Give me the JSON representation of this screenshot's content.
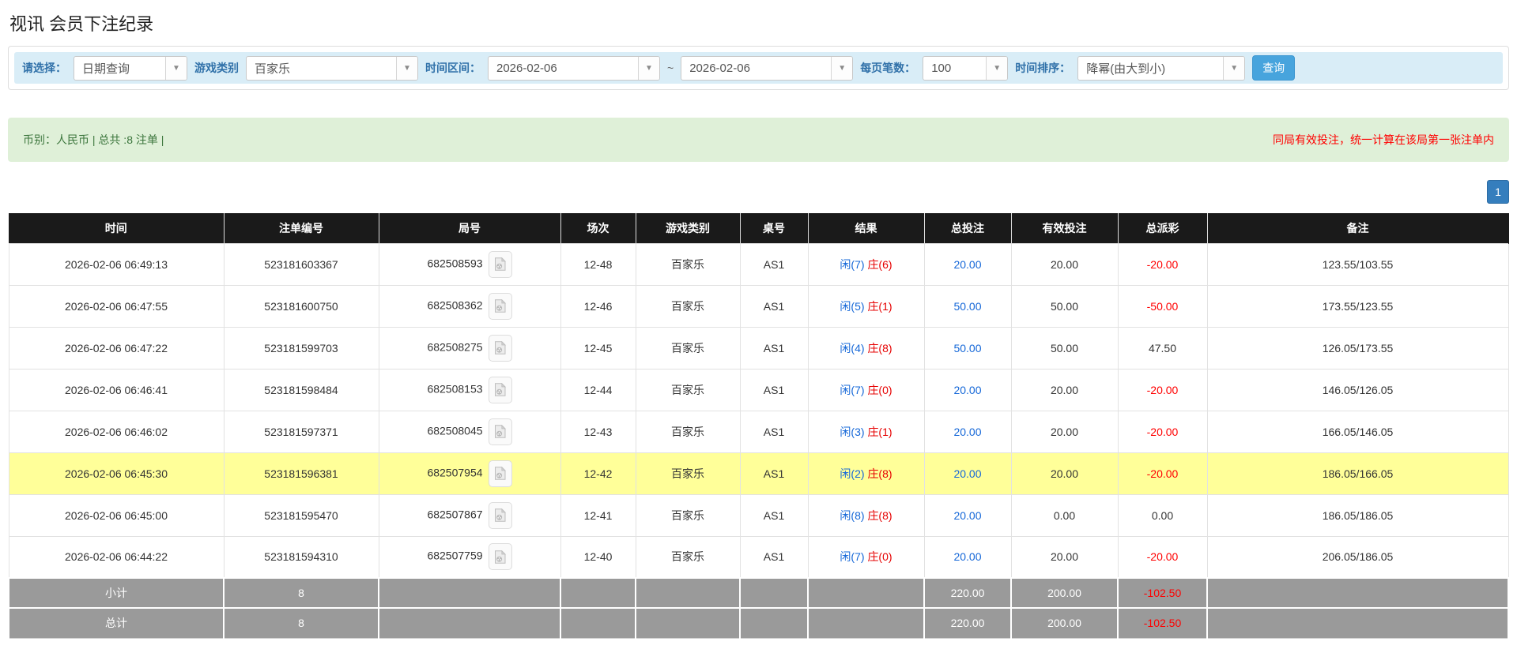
{
  "page": {
    "title": "视讯 会员下注纪录"
  },
  "icons": {
    "dropdown_arrow": "▼"
  },
  "colors": {
    "filter_bg": "#d9edf7",
    "filter_label": "#3071a9",
    "search_button": "#47a4dd",
    "summary_bg": "#dff0d8",
    "summary_text": "#3c763d",
    "alert_red": "#ff0000",
    "header_bg": "#1a1a1a",
    "highlight_row": "#ffff99",
    "footer_bg": "#9a9a9a",
    "value_blue": "#1668d8",
    "banker_red": "#e60000",
    "pagination_blue": "#357ebd"
  },
  "filters": {
    "select_label": "请选择：",
    "select_value": "日期查询",
    "game_type_label": "游戏类别",
    "game_type_value": "百家乐",
    "time_range_label": "时间区间：",
    "date_from": "2026-02-06",
    "tilde": "~",
    "date_to": "2026-02-06",
    "page_size_label": "每页笔数：",
    "page_size_value": "100",
    "sort_label": "时间排序：",
    "sort_value": "降幂(由大到小)",
    "search_button": "查询"
  },
  "summary": {
    "left": "币别：人民币 | 总共 :8 注单 |",
    "right": "同局有效投注，统一计算在该局第一张注单内"
  },
  "pagination": {
    "current": "1"
  },
  "table": {
    "headers": [
      "时间",
      "注单编号",
      "局号",
      "场次",
      "游戏类别",
      "桌号",
      "结果",
      "总投注",
      "有效投注",
      "总派彩",
      "备注"
    ],
    "rows": [
      {
        "time": "2026-02-06 06:49:13",
        "bet_id": "523181603367",
        "round_id": "682508593",
        "session": "12-48",
        "game_type": "百家乐",
        "table_no": "AS1",
        "result_player": "闲(7)",
        "result_banker": "庄(6)",
        "total_bet": "20.00",
        "valid_bet": "20.00",
        "payout": "-20.00",
        "remark": "123.55/103.55",
        "highlighted": false
      },
      {
        "time": "2026-02-06 06:47:55",
        "bet_id": "523181600750",
        "round_id": "682508362",
        "session": "12-46",
        "game_type": "百家乐",
        "table_no": "AS1",
        "result_player": "闲(5)",
        "result_banker": "庄(1)",
        "total_bet": "50.00",
        "valid_bet": "50.00",
        "payout": "-50.00",
        "remark": "173.55/123.55",
        "highlighted": false
      },
      {
        "time": "2026-02-06 06:47:22",
        "bet_id": "523181599703",
        "round_id": "682508275",
        "session": "12-45",
        "game_type": "百家乐",
        "table_no": "AS1",
        "result_player": "闲(4)",
        "result_banker": "庄(8)",
        "total_bet": "50.00",
        "valid_bet": "50.00",
        "payout": "47.50",
        "remark": "126.05/173.55",
        "highlighted": false
      },
      {
        "time": "2026-02-06 06:46:41",
        "bet_id": "523181598484",
        "round_id": "682508153",
        "session": "12-44",
        "game_type": "百家乐",
        "table_no": "AS1",
        "result_player": "闲(7)",
        "result_banker": "庄(0)",
        "total_bet": "20.00",
        "valid_bet": "20.00",
        "payout": "-20.00",
        "remark": "146.05/126.05",
        "highlighted": false
      },
      {
        "time": "2026-02-06 06:46:02",
        "bet_id": "523181597371",
        "round_id": "682508045",
        "session": "12-43",
        "game_type": "百家乐",
        "table_no": "AS1",
        "result_player": "闲(3)",
        "result_banker": "庄(1)",
        "total_bet": "20.00",
        "valid_bet": "20.00",
        "payout": "-20.00",
        "remark": "166.05/146.05",
        "highlighted": false
      },
      {
        "time": "2026-02-06 06:45:30",
        "bet_id": "523181596381",
        "round_id": "682507954",
        "session": "12-42",
        "game_type": "百家乐",
        "table_no": "AS1",
        "result_player": "闲(2)",
        "result_banker": "庄(8)",
        "total_bet": "20.00",
        "valid_bet": "20.00",
        "payout": "-20.00",
        "remark": "186.05/166.05",
        "highlighted": true
      },
      {
        "time": "2026-02-06 06:45:00",
        "bet_id": "523181595470",
        "round_id": "682507867",
        "session": "12-41",
        "game_type": "百家乐",
        "table_no": "AS1",
        "result_player": "闲(8)",
        "result_banker": "庄(8)",
        "total_bet": "20.00",
        "valid_bet": "0.00",
        "payout": "0.00",
        "remark": "186.05/186.05",
        "highlighted": false
      },
      {
        "time": "2026-02-06 06:44:22",
        "bet_id": "523181594310",
        "round_id": "682507759",
        "session": "12-40",
        "game_type": "百家乐",
        "table_no": "AS1",
        "result_player": "闲(7)",
        "result_banker": "庄(0)",
        "total_bet": "20.00",
        "valid_bet": "20.00",
        "payout": "-20.00",
        "remark": "206.05/186.05",
        "highlighted": false
      }
    ],
    "subtotal": {
      "label": "小计",
      "count": "8",
      "total_bet": "220.00",
      "valid_bet": "200.00",
      "payout": "-102.50"
    },
    "total": {
      "label": "总计",
      "count": "8",
      "total_bet": "220.00",
      "valid_bet": "200.00",
      "payout": "-102.50"
    }
  }
}
